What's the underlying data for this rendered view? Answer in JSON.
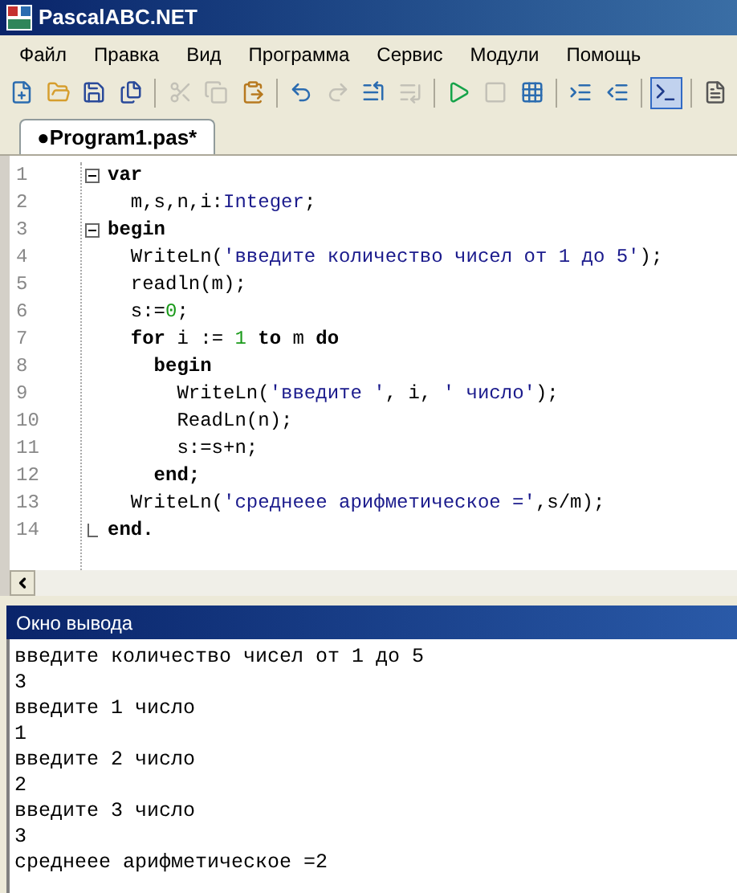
{
  "window": {
    "title": "PascalABC.NET"
  },
  "menu": [
    "Файл",
    "Правка",
    "Вид",
    "Программа",
    "Сервис",
    "Модули",
    "Помощь"
  ],
  "toolbar": [
    {
      "kind": "button",
      "disabled": false,
      "pressed": false
    },
    {
      "kind": "button",
      "disabled": false,
      "pressed": false
    },
    {
      "kind": "button",
      "disabled": false,
      "pressed": false
    },
    {
      "kind": "button",
      "disabled": false,
      "pressed": false
    },
    {
      "kind": "separator"
    },
    {
      "kind": "button",
      "disabled": true,
      "pressed": false
    },
    {
      "kind": "button",
      "disabled": true,
      "pressed": false
    },
    {
      "kind": "button",
      "disabled": false,
      "pressed": false
    },
    {
      "kind": "separator"
    },
    {
      "kind": "button",
      "disabled": false,
      "pressed": false
    },
    {
      "kind": "button",
      "disabled": true,
      "pressed": false
    },
    {
      "kind": "button",
      "disabled": false,
      "pressed": false
    },
    {
      "kind": "button",
      "disabled": true,
      "pressed": false
    },
    {
      "kind": "separator"
    },
    {
      "kind": "button",
      "disabled": false,
      "pressed": false
    },
    {
      "kind": "button",
      "disabled": true,
      "pressed": false
    },
    {
      "kind": "button",
      "disabled": false,
      "pressed": false
    },
    {
      "kind": "separator"
    },
    {
      "kind": "button",
      "disabled": false,
      "pressed": false
    },
    {
      "kind": "button",
      "disabled": false,
      "pressed": false
    },
    {
      "kind": "separator"
    },
    {
      "kind": "button",
      "disabled": false,
      "pressed": true
    },
    {
      "kind": "separator"
    },
    {
      "kind": "button",
      "disabled": false,
      "pressed": false
    }
  ],
  "tabs": [
    {
      "label": "●Program1.pas*",
      "selected": true
    }
  ],
  "editor": {
    "lines": [
      {
        "number": "1",
        "fold_toggle": true,
        "fold_end": false,
        "tokens": [
          {
            "text": "var",
            "kind": "keyword"
          }
        ]
      },
      {
        "number": "2",
        "fold_toggle": false,
        "fold_end": false,
        "tokens": [
          {
            "text": "  m,s,n,i:",
            "kind": "plain"
          },
          {
            "text": "Integer",
            "kind": "type"
          },
          {
            "text": ";",
            "kind": "plain"
          }
        ]
      },
      {
        "number": "3",
        "fold_toggle": true,
        "fold_end": false,
        "tokens": [
          {
            "text": "begin",
            "kind": "keyword"
          }
        ]
      },
      {
        "number": "4",
        "fold_toggle": false,
        "fold_end": false,
        "tokens": [
          {
            "text": "  WriteLn(",
            "kind": "plain"
          },
          {
            "text": "'введите количество чисел от 1 до 5'",
            "kind": "string"
          },
          {
            "text": ");",
            "kind": "plain"
          }
        ]
      },
      {
        "number": "5",
        "fold_toggle": false,
        "fold_end": false,
        "tokens": [
          {
            "text": "  readln(m);",
            "kind": "plain"
          }
        ]
      },
      {
        "number": "6",
        "fold_toggle": false,
        "fold_end": false,
        "tokens": [
          {
            "text": "  s:=",
            "kind": "plain"
          },
          {
            "text": "0",
            "kind": "number"
          },
          {
            "text": ";",
            "kind": "plain"
          }
        ]
      },
      {
        "number": "7",
        "fold_toggle": false,
        "fold_end": false,
        "tokens": [
          {
            "text": "  for",
            "kind": "keyword"
          },
          {
            "text": " i := ",
            "kind": "plain"
          },
          {
            "text": "1",
            "kind": "number"
          },
          {
            "text": " to",
            "kind": "keyword"
          },
          {
            "text": " m ",
            "kind": "plain"
          },
          {
            "text": "do",
            "kind": "keyword"
          }
        ]
      },
      {
        "number": "8",
        "fold_toggle": false,
        "fold_end": false,
        "tokens": [
          {
            "text": "    begin",
            "kind": "keyword"
          }
        ]
      },
      {
        "number": "9",
        "fold_toggle": false,
        "fold_end": false,
        "tokens": [
          {
            "text": "      WriteLn(",
            "kind": "plain"
          },
          {
            "text": "'введите '",
            "kind": "string"
          },
          {
            "text": ", i, ",
            "kind": "plain"
          },
          {
            "text": "' число'",
            "kind": "string"
          },
          {
            "text": ");",
            "kind": "plain"
          }
        ]
      },
      {
        "number": "10",
        "fold_toggle": false,
        "fold_end": false,
        "tokens": [
          {
            "text": "      ReadLn(n);",
            "kind": "plain"
          }
        ]
      },
      {
        "number": "11",
        "fold_toggle": false,
        "fold_end": false,
        "tokens": [
          {
            "text": "      s:=s+n;",
            "kind": "plain"
          }
        ]
      },
      {
        "number": "12",
        "fold_toggle": false,
        "fold_end": false,
        "tokens": [
          {
            "text": "    end;",
            "kind": "keyword"
          }
        ]
      },
      {
        "number": "13",
        "fold_toggle": false,
        "fold_end": false,
        "tokens": [
          {
            "text": "  WriteLn(",
            "kind": "plain"
          },
          {
            "text": "'среднеее арифметическое ='",
            "kind": "string"
          },
          {
            "text": ",s/m);",
            "kind": "plain"
          }
        ]
      },
      {
        "number": "14",
        "fold_toggle": false,
        "fold_end": true,
        "tokens": [
          {
            "text": "end.",
            "kind": "keyword"
          }
        ]
      }
    ]
  },
  "output": {
    "title": "Окно вывода",
    "lines": [
      "введите количество чисел от 1 до 5",
      "3",
      "введите 1 число",
      "1",
      "введите 2 число",
      "2",
      "введите 3 число",
      "3",
      "среднеее арифметическое =2"
    ]
  }
}
